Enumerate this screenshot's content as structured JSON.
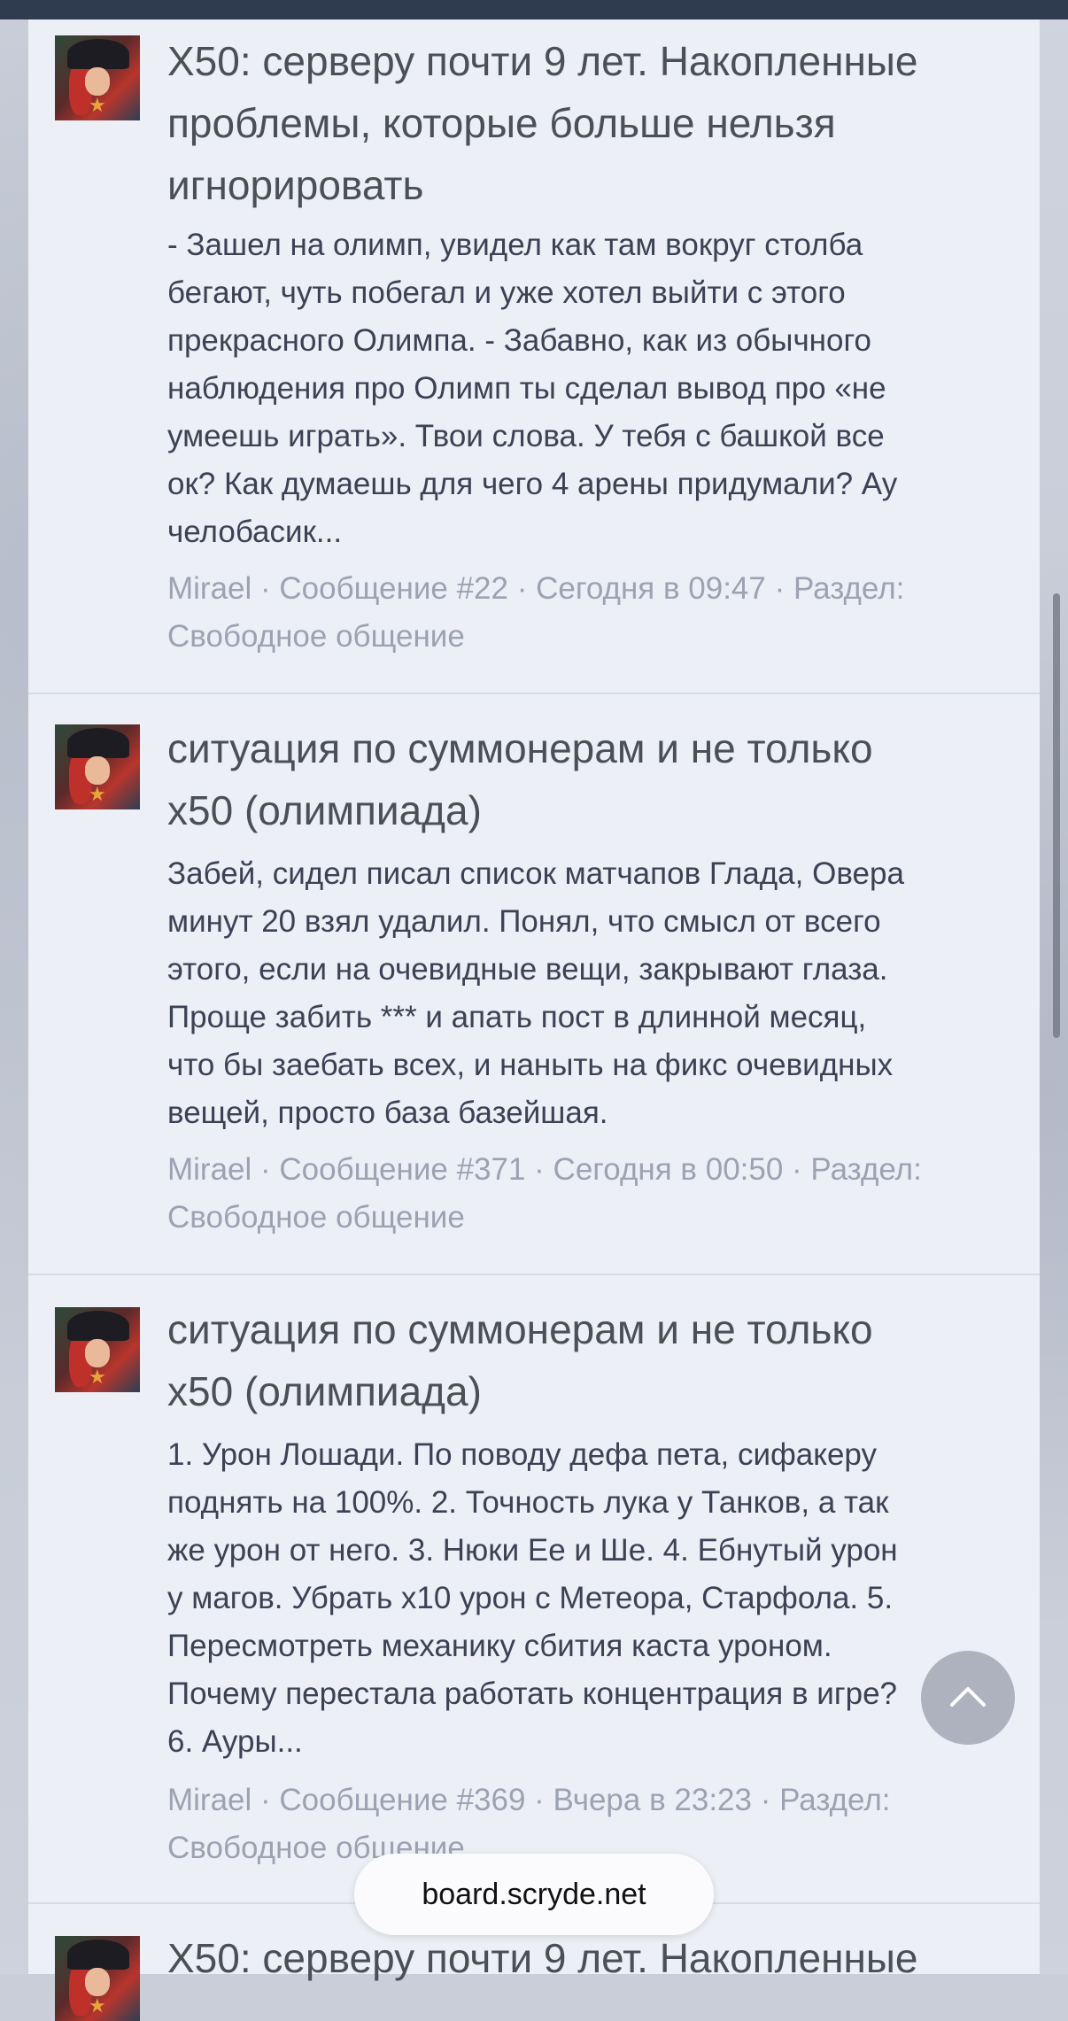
{
  "posts": [
    {
      "title": "X50: серверу почти 9 лет. Накопленные проблемы, которые больше нельзя игнорировать",
      "title_lines": [
        "X50: серверу почти 9 лет. Накопленные",
        "проблемы, которые больше нельзя",
        "игнорировать"
      ],
      "snippet_lines": [
        "- Зашел на олимп, увидел как там вокруг столба",
        "бегают, чуть побегал и уже хотел выйти с этого",
        "прекрасного Олимпа. - Забавно, как из обычного",
        "наблюдения про Олимп ты сделал вывод про «не",
        "умеешь играть». Твои слова. У тебя с башкой все",
        "ок? Как думаешь для чего 4 арены придумали? Ау",
        "челобасик..."
      ],
      "meta_lines": [
        "Mirael · Сообщение #22 · Сегодня в 09:47 · Раздел:",
        "Свободное общение"
      ]
    },
    {
      "title": "ситуация по суммонерам и не только x50 (олимпиада)",
      "title_lines": [
        "ситуация по суммонерам и не только",
        "x50 (олимпиада)"
      ],
      "snippet_lines": [
        "Забей, сидел писал список матчапов Глада, Овера",
        "минут 20 взял удалил. Понял, что смысл от всего",
        "этого, если на очевидные вещи, закрывают глаза.",
        "Проще забить *** и апать пост в длинной месяц,",
        "что бы заебать всех, и наныть на фикс очевидных",
        "вещей, просто база базейшая."
      ],
      "meta_lines": [
        "Mirael · Сообщение #371 · Сегодня в 00:50 · Раздел:",
        "Свободное общение"
      ]
    },
    {
      "title": "ситуация по суммонерам и не только x50 (олимпиада)",
      "title_lines": [
        "ситуация по суммонерам и не только",
        "x50 (олимпиада)"
      ],
      "snippet_lines": [
        "1. Урон Лошади. По поводу дефа пета, сифакеру",
        "поднять на 100%. 2. Точность лука у Танков, а так",
        "же урон от него. 3. Нюки Ее и Ше. 4. Ебнутый урон",
        "у магов. Убрать х10 урон с Метеора, Старфола. 5.",
        "Пересмотреть механику сбития каста уроном.",
        "Почему перестала работать концентрация в игре?",
        "6. Ауры..."
      ],
      "meta_lines": [
        "Mirael · Сообщение #369 · Вчера в 23:23 · Раздел:",
        "Свободное общение"
      ]
    },
    {
      "title_lines": [
        "X50: серверу почти 9 лет. Накопленные"
      ]
    }
  ],
  "browser": {
    "url": "board.scryde.net"
  },
  "icons": {
    "scroll_top": "chevron-up-icon"
  },
  "colors": {
    "title": "#4b4f58",
    "snippet": "#3c4154",
    "meta": "#9da2b2",
    "panel": "#eceff6",
    "topbar": "#2f3b4f"
  }
}
